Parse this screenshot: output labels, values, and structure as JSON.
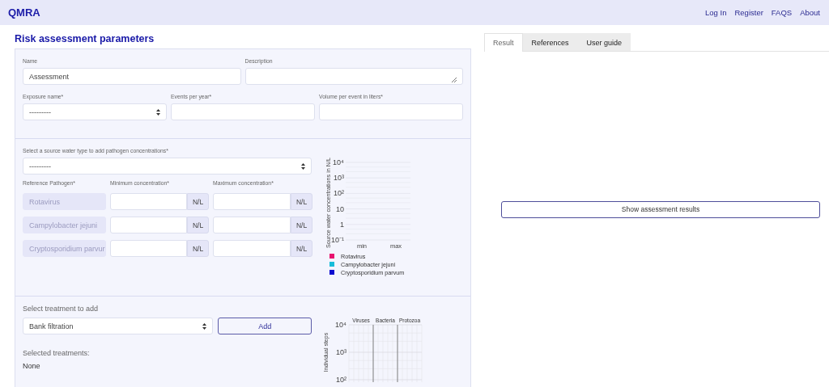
{
  "navbar": {
    "logo": "QMRA",
    "links": [
      "Log In",
      "Register",
      "FAQS",
      "About"
    ]
  },
  "title": "Risk assessment parameters",
  "general_fields": [
    {
      "kind": "text",
      "label": "Name",
      "value": "Assessment"
    },
    {
      "kind": "textarea",
      "label": "Description"
    }
  ],
  "exposure_fields": [
    {
      "kind": "select",
      "label": "Exposure name*",
      "value": "---------"
    },
    {
      "kind": "text",
      "label": "Events per year*"
    },
    {
      "kind": "text",
      "label": "Volume per event in liters*"
    }
  ],
  "source_water": {
    "label": "Select a source water type to add pathogen concentrations*",
    "value": "---------",
    "columns": [
      "Reference Pathogen*",
      "Minimum concentration*",
      "Maximum concentration*"
    ],
    "rows": [
      {
        "pathogen": "Rotavirus",
        "disabled": true,
        "min_unit": "N/L",
        "max_unit": "N/L"
      },
      {
        "pathogen": "Campylobacter jejuni",
        "disabled": true,
        "min_unit": "N/L",
        "max_unit": "N/L"
      },
      {
        "pathogen": "Cryptosporidium parvur",
        "disabled": true,
        "min_unit": "N/L",
        "max_unit": "N/L"
      }
    ],
    "chart": {
      "y_title": "Source water concentrations in N/L",
      "x_labels": [
        "min",
        "max"
      ],
      "y_labels": [
        "10⁴",
        "10³",
        "10²",
        "10",
        "1",
        "10⁻¹"
      ],
      "legend": [
        {
          "name": "Rotavirus",
          "color": "#e8136f"
        },
        {
          "name": "Campylobacter jejuni",
          "color": "#17bcd9"
        },
        {
          "name": "Cryptosporidium parvum",
          "color": "#0b0bd0"
        }
      ]
    }
  },
  "treatment": {
    "label": "Select treatment to add",
    "value": "Bank filtration",
    "add_button": "Add",
    "selected_label": "Selected treatments:",
    "selected_value": "None",
    "chart": {
      "y_title": "Individual steps",
      "categories": [
        "Viruses",
        "Bacteria",
        "Protozoa"
      ],
      "y_labels": [
        "10⁴",
        "10³",
        "10²"
      ]
    }
  },
  "result_panel": {
    "tabs": [
      {
        "label": "Result",
        "selected": true
      },
      {
        "label": "References",
        "selected": false
      },
      {
        "label": "User guide",
        "selected": false
      }
    ],
    "button": "Show assessment results"
  }
}
